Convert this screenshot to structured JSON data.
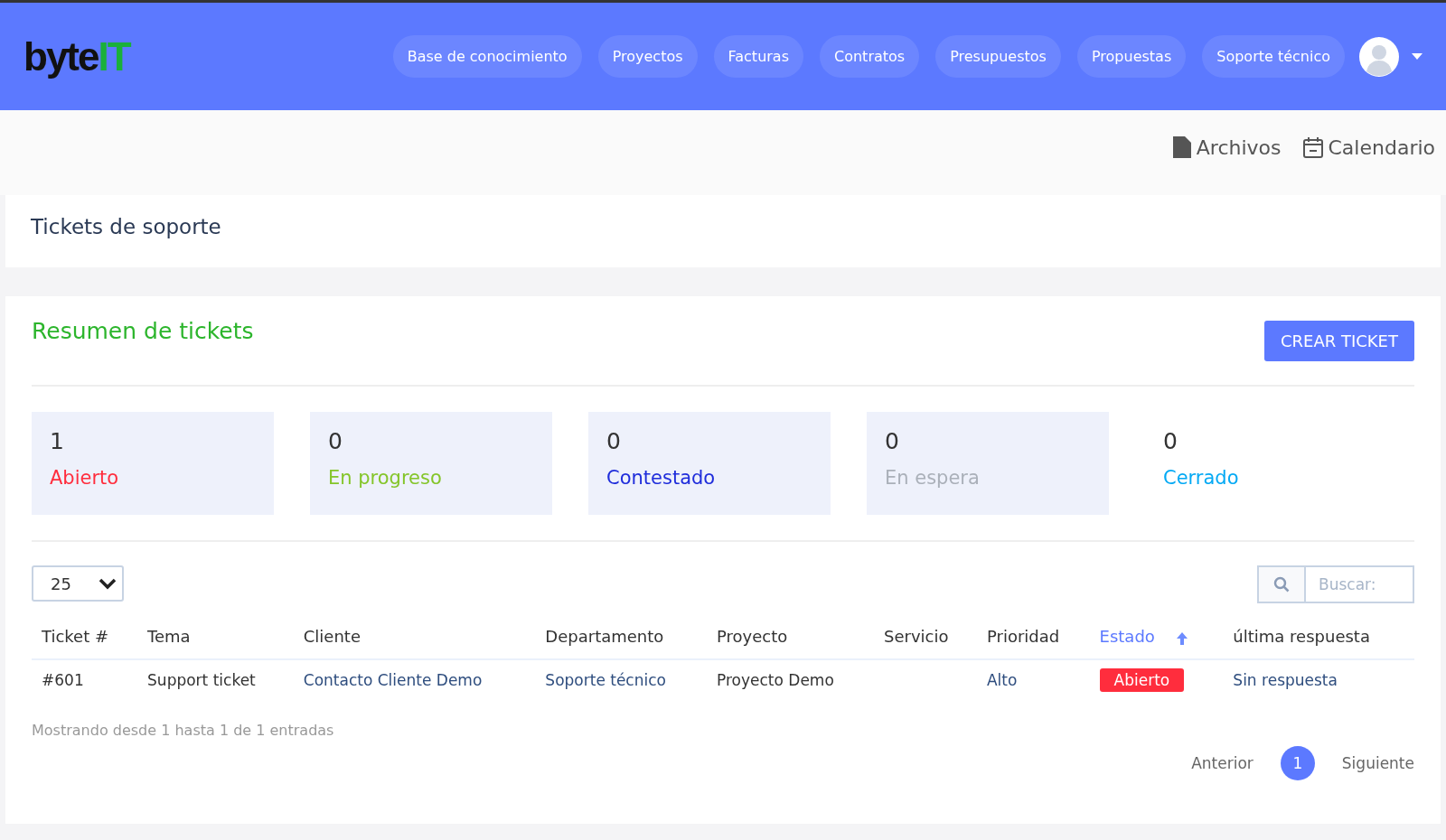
{
  "logo": {
    "text": "byte",
    "accent": "IT"
  },
  "nav": [
    {
      "label": "Base de conocimiento"
    },
    {
      "label": "Proyectos"
    },
    {
      "label": "Facturas"
    },
    {
      "label": "Contratos"
    },
    {
      "label": "Presupuestos"
    },
    {
      "label": "Propuestas"
    },
    {
      "label": "Soporte técnico"
    }
  ],
  "quick_links": [
    {
      "kind": "file",
      "label": "Archivos"
    },
    {
      "kind": "calendar",
      "label": "Calendario"
    }
  ],
  "page_title": "Tickets de soporte",
  "summary": {
    "title": "Resumen de tickets",
    "button": "CREAR TICKET",
    "stats": [
      {
        "count": "1",
        "label": "Abierto",
        "color": "#ff2d3d",
        "shaded": true
      },
      {
        "count": "0",
        "label": "En progreso",
        "color": "#84c529",
        "shaded": true
      },
      {
        "count": "0",
        "label": "Contestado",
        "color": "#1f2ddb",
        "shaded": true
      },
      {
        "count": "0",
        "label": "En espera",
        "color": "#aab0b9",
        "shaded": true
      },
      {
        "count": "0",
        "label": "Cerrado",
        "color": "#03a9f4",
        "shaded": false
      }
    ]
  },
  "table": {
    "page_size": "25",
    "search": {
      "placeholder": "Buscar:"
    },
    "columns": [
      {
        "label": "Ticket #",
        "sorted": false
      },
      {
        "label": "Tema",
        "sorted": false
      },
      {
        "label": "Cliente",
        "sorted": false
      },
      {
        "label": "Departamento",
        "sorted": false
      },
      {
        "label": "Proyecto",
        "sorted": false
      },
      {
        "label": "Servicio",
        "sorted": false
      },
      {
        "label": "Prioridad",
        "sorted": false
      },
      {
        "label": "Estado",
        "sorted": true
      },
      {
        "label": "última respuesta",
        "sorted": false
      }
    ],
    "rows": [
      {
        "cells": [
          {
            "kind": "text",
            "text": "#601"
          },
          {
            "kind": "text",
            "text": "Support ticket"
          },
          {
            "kind": "link",
            "text": "Contacto Cliente Demo"
          },
          {
            "kind": "link",
            "text": "Soporte técnico"
          },
          {
            "kind": "text",
            "text": "Proyecto Demo"
          },
          {
            "kind": "empty"
          },
          {
            "kind": "link",
            "text": "Alto"
          },
          {
            "kind": "badge",
            "text": "Abierto",
            "color": "#ff2d3d"
          },
          {
            "kind": "link",
            "text": "Sin respuesta"
          }
        ]
      }
    ],
    "info": "Mostrando desde 1 hasta 1 de 1 entradas",
    "pagination": [
      {
        "kind": "prev",
        "label": "Anterior"
      },
      {
        "kind": "page",
        "label": "1",
        "selected": true
      },
      {
        "kind": "next",
        "label": "Siguiente"
      }
    ]
  }
}
